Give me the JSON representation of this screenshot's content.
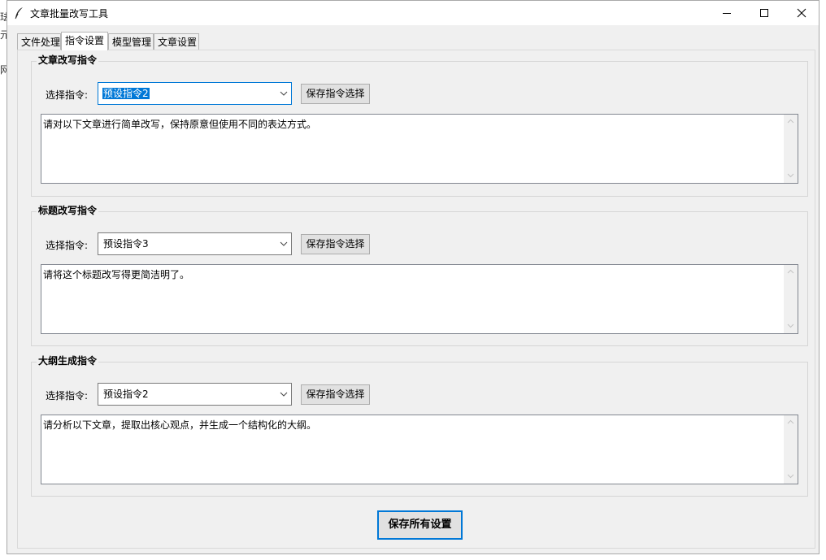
{
  "window": {
    "title": "文章批量改写工具"
  },
  "tabs": [
    {
      "label": "文件处理",
      "active": false
    },
    {
      "label": "指令设置",
      "active": true
    },
    {
      "label": "模型管理",
      "active": false
    },
    {
      "label": "文章设置",
      "active": false
    }
  ],
  "groups": [
    {
      "title": "文章改写指令",
      "select_label": "选择指令:",
      "selected": "预设指令2",
      "save_button": "保存指令选择",
      "text": "请对以下文章进行简单改写，保持原意但使用不同的表达方式。"
    },
    {
      "title": "标题改写指令",
      "select_label": "选择指令:",
      "selected": "预设指令3",
      "save_button": "保存指令选择",
      "text": "请将这个标题改写得更简洁明了。"
    },
    {
      "title": "大纲生成指令",
      "select_label": "选择指令:",
      "selected": "预设指令2",
      "save_button": "保存指令选择",
      "text": "请分析以下文章，提取出核心观点，并生成一个结构化的大纲。"
    }
  ],
  "save_all_button": "保存所有设置",
  "icons": {
    "app": "feather-icon",
    "minimize": "minimize-icon",
    "maximize": "maximize-icon",
    "close": "close-icon",
    "dropdown": "chevron-down-icon",
    "scroll_up": "scroll-up-icon",
    "scroll_down": "scroll-down-icon"
  },
  "colors": {
    "focus_accent": "#0078d7",
    "window_bg": "#f0f0f0",
    "button_bg": "#e1e1e1"
  }
}
